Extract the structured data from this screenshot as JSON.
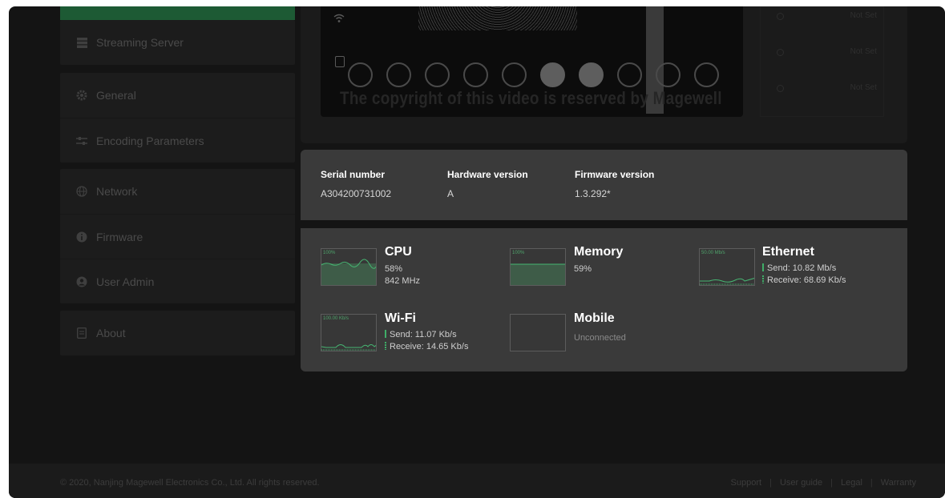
{
  "sidebar": {
    "items": [
      {
        "label": "Streaming Server",
        "icon": "server-icon"
      },
      {
        "label": "General",
        "icon": "gear-icon"
      },
      {
        "label": "Encoding Parameters",
        "icon": "sliders-icon"
      },
      {
        "label": "Network",
        "icon": "globe-icon"
      },
      {
        "label": "Firmware",
        "icon": "info-icon"
      },
      {
        "label": "User Admin",
        "icon": "user-icon"
      },
      {
        "label": "About",
        "icon": "document-icon"
      }
    ]
  },
  "preview": {
    "watermark": "The copyright of this video is reserved by Magewell",
    "slots": [
      "Not Set",
      "Not Set",
      "Not Set"
    ]
  },
  "device": {
    "serial_label": "Serial number",
    "serial_value": "A304200731002",
    "hardware_label": "Hardware version",
    "hardware_value": "A",
    "firmware_label": "Firmware version",
    "firmware_value": "1.3.292*"
  },
  "stats": {
    "cpu": {
      "name": "CPU",
      "scale": "100%",
      "usage": "58%",
      "freq": "842 MHz",
      "level": 0.58
    },
    "memory": {
      "name": "Memory",
      "scale": "100%",
      "usage": "59%",
      "level": 0.59
    },
    "ethernet": {
      "name": "Ethernet",
      "scale": "50.00 Mb/s",
      "send": "Send: 10.82 Mb/s",
      "receive": "Receive: 68.69 Kb/s"
    },
    "wifi": {
      "name": "Wi-Fi",
      "scale": "100.00 Kb/s",
      "send": "Send: 11.07 Kb/s",
      "receive": "Receive: 14.65 Kb/s"
    },
    "mobile": {
      "name": "Mobile",
      "status": "Unconnected"
    }
  },
  "footer": {
    "copyright": "© 2020, Nanjing Magewell Electronics Co., Ltd. All rights reserved.",
    "links": [
      "Support",
      "User guide",
      "Legal",
      "Warranty"
    ]
  },
  "colors": {
    "accent": "#3fae68",
    "card": "#3a3a3a",
    "background": "#141414"
  }
}
